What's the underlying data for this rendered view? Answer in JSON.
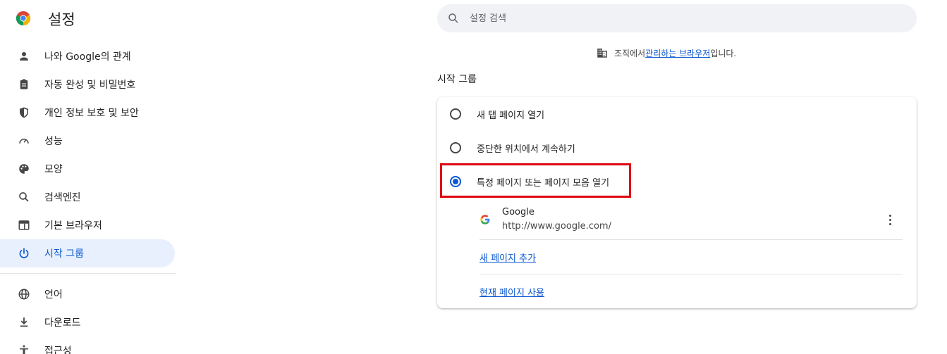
{
  "app": {
    "title": "설정",
    "logo_icon": "chrome-logo"
  },
  "search": {
    "placeholder": "설정 검색",
    "value": ""
  },
  "sidebar": {
    "items": [
      {
        "label": "나와 Google의 관계",
        "icon": "person-icon",
        "active": false
      },
      {
        "label": "자동 완성 및 비밀번호",
        "icon": "clipboard-icon",
        "active": false
      },
      {
        "label": "개인 정보 보호 및 보안",
        "icon": "shield-icon",
        "active": false
      },
      {
        "label": "성능",
        "icon": "speedometer-icon",
        "active": false
      },
      {
        "label": "모양",
        "icon": "palette-icon",
        "active": false
      },
      {
        "label": "검색엔진",
        "icon": "search-icon",
        "active": false
      },
      {
        "label": "기본 브라우저",
        "icon": "browser-icon",
        "active": false
      },
      {
        "label": "시작 그룹",
        "icon": "power-icon",
        "active": true
      },
      {
        "label": "언어",
        "icon": "globe-icon",
        "active": false
      },
      {
        "label": "다운로드",
        "icon": "download-icon",
        "active": false
      },
      {
        "label": "접근성",
        "icon": "accessibility-icon",
        "active": false
      }
    ]
  },
  "managed_notice": {
    "prefix": "조직에서 ",
    "link": "관리하는 브라우저",
    "suffix": "입니다."
  },
  "startup": {
    "section_title": "시작 그룹",
    "options": [
      {
        "label": "새 탭 페이지 열기",
        "checked": false
      },
      {
        "label": "중단한 위치에서 계속하기",
        "checked": false
      },
      {
        "label": "특정 페이지 또는 페이지 모음 열기",
        "checked": true
      }
    ],
    "pages": [
      {
        "name": "Google",
        "url": "http://www.google.com/"
      }
    ],
    "add_page_link": "새 페이지 추가",
    "use_current_link": "현재 페이지 사용"
  },
  "colors": {
    "accent": "#0b57d0",
    "active_bg": "#e8f0fe",
    "highlight": "#e0000f"
  }
}
